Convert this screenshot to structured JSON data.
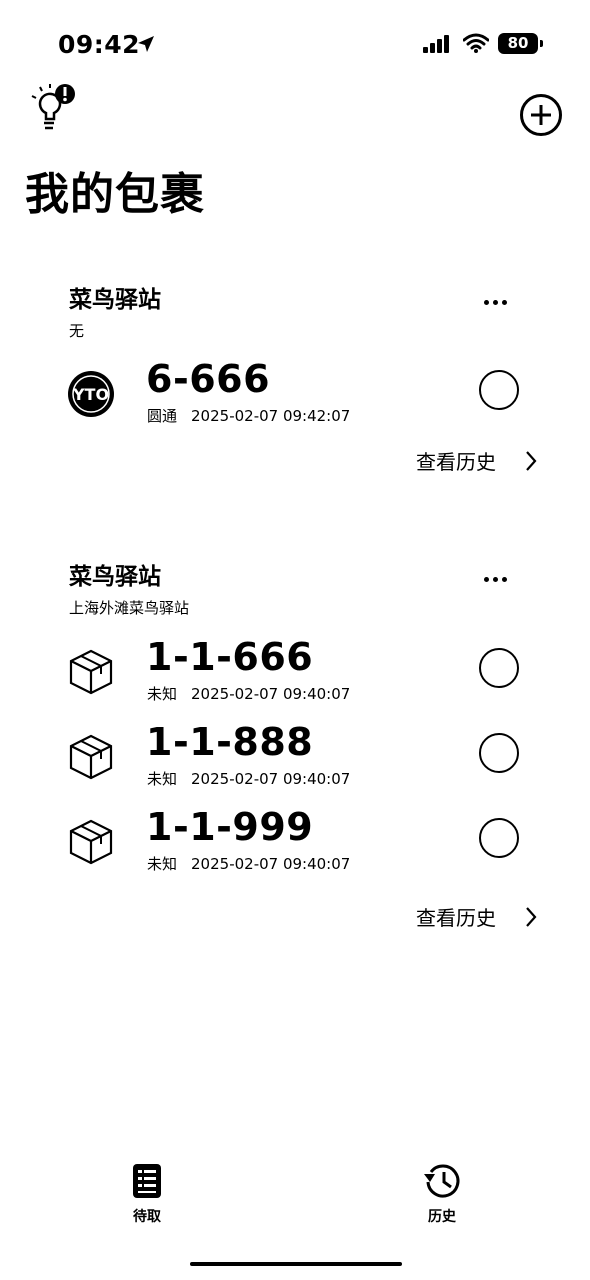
{
  "status_bar": {
    "time": "09:42",
    "battery": "80"
  },
  "header": {
    "title": "我的包裹"
  },
  "groups": [
    {
      "title": "菜鸟驿站",
      "subtitle": "无",
      "history_label": "查看历史",
      "parcels": [
        {
          "code": "6-666",
          "carrier": "圆通",
          "time": "2025-02-07 09:42:07",
          "icon": "yto-logo-icon"
        }
      ]
    },
    {
      "title": "菜鸟驿站",
      "subtitle": "上海外滩菜鸟驿站",
      "history_label": "查看历史",
      "parcels": [
        {
          "code": "1-1-666",
          "carrier": "未知",
          "time": "2025-02-07 09:40:07",
          "icon": "package-box-icon"
        },
        {
          "code": "1-1-888",
          "carrier": "未知",
          "time": "2025-02-07 09:40:07",
          "icon": "package-box-icon"
        },
        {
          "code": "1-1-999",
          "carrier": "未知",
          "time": "2025-02-07 09:40:07",
          "icon": "package-box-icon"
        }
      ]
    }
  ],
  "tabbar": {
    "tabs": [
      {
        "label": "待取",
        "icon": "clipboard-list-icon"
      },
      {
        "label": "历史",
        "icon": "history-clock-icon"
      }
    ]
  }
}
